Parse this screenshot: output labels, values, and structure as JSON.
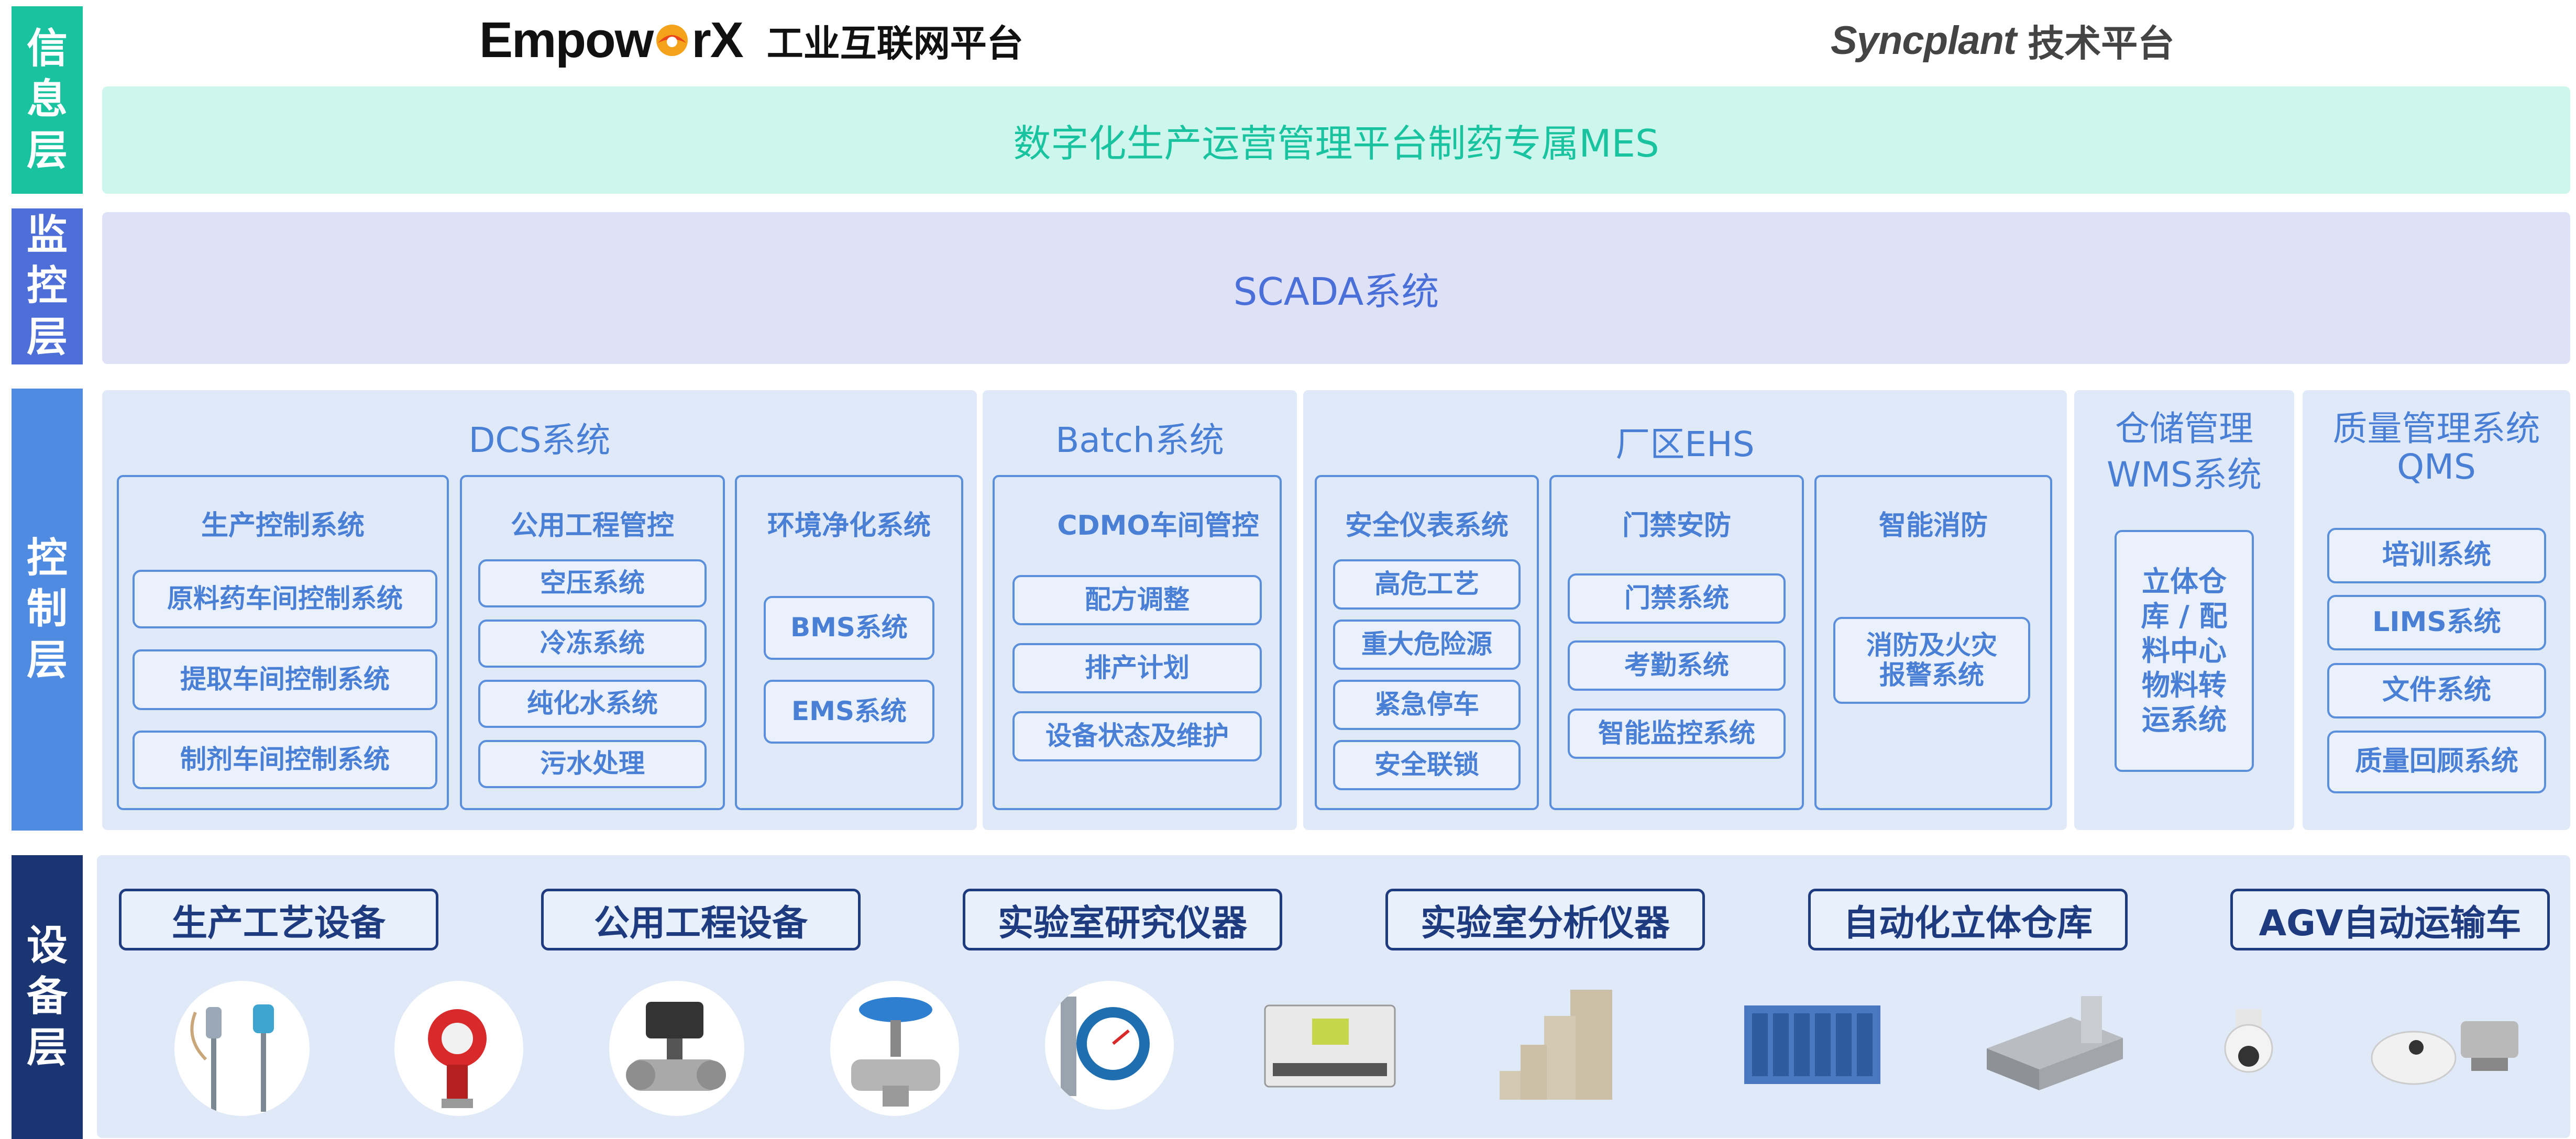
{
  "layers": {
    "info": "信息层",
    "monitor": "监控层",
    "control": "控制层",
    "device": "设备层"
  },
  "header": {
    "brand_pre": "Empow",
    "brand_post": "rX",
    "brand_subtitle": "工业互联网平台",
    "sync_name": "Syncplant",
    "sync_subtitle": "技术平台"
  },
  "info_layer": {
    "mes": "数字化生产运营管理平台制药专属MES"
  },
  "monitor_layer": {
    "scada": "SCADA系统"
  },
  "control_layer": {
    "dcs": {
      "title": "DCS系统",
      "groups": [
        {
          "title": "生产控制系统",
          "items": [
            "原料药车间控制系统",
            "提取车间控制系统",
            "制剂车间控制系统"
          ]
        },
        {
          "title": "公用工程管控",
          "items": [
            "空压系统",
            "冷冻系统",
            "纯化水系统",
            "污水处理"
          ]
        },
        {
          "title": "环境净化系统",
          "items": [
            "BMS系统",
            "EMS系统"
          ]
        }
      ]
    },
    "batch": {
      "title": "Batch系统",
      "group": {
        "title": "CDMO车间管控",
        "items": [
          "配方调整",
          "排产计划",
          "设备状态及维护"
        ]
      }
    },
    "ehs": {
      "title": "厂区EHS",
      "groups": [
        {
          "title": "安全仪表系统",
          "items": [
            "高危工艺",
            "重大危险源",
            "紧急停车",
            "安全联锁"
          ]
        },
        {
          "title": "门禁安防",
          "items": [
            "门禁系统",
            "考勤系统",
            "智能监控系统"
          ]
        },
        {
          "title": "智能消防",
          "items": [
            "消防及火灾报警系统"
          ]
        }
      ]
    },
    "wms": {
      "title_line1": "仓储管理",
      "title_line2": "WMS系统",
      "item_lines": [
        "立体仓",
        "库 / 配",
        "料中心",
        "物料转",
        "运系统"
      ]
    },
    "qms": {
      "title_line1": "质量管理系统",
      "title_line2": "QMS",
      "items": [
        "培训系统",
        "LIMS系统",
        "文件系统",
        "质量回顾系统"
      ]
    }
  },
  "device_layer": {
    "categories": [
      "生产工艺设备",
      "公用工程设备",
      "实验室研究仪器",
      "实验室分析仪器",
      "自动化立体仓库",
      "AGV自动运输车"
    ]
  },
  "colors": {
    "info_bar": "#19c3a0",
    "monitor_bar": "#4f6fd8",
    "control_bar": "#4f8be0",
    "device_bar": "#1b3472",
    "mes_text": "#19c3a0",
    "scada_text": "#4a6fd8",
    "control_text": "#4a7fd6",
    "device_text": "#1f3b80",
    "brand_accent": "#e8451b"
  }
}
